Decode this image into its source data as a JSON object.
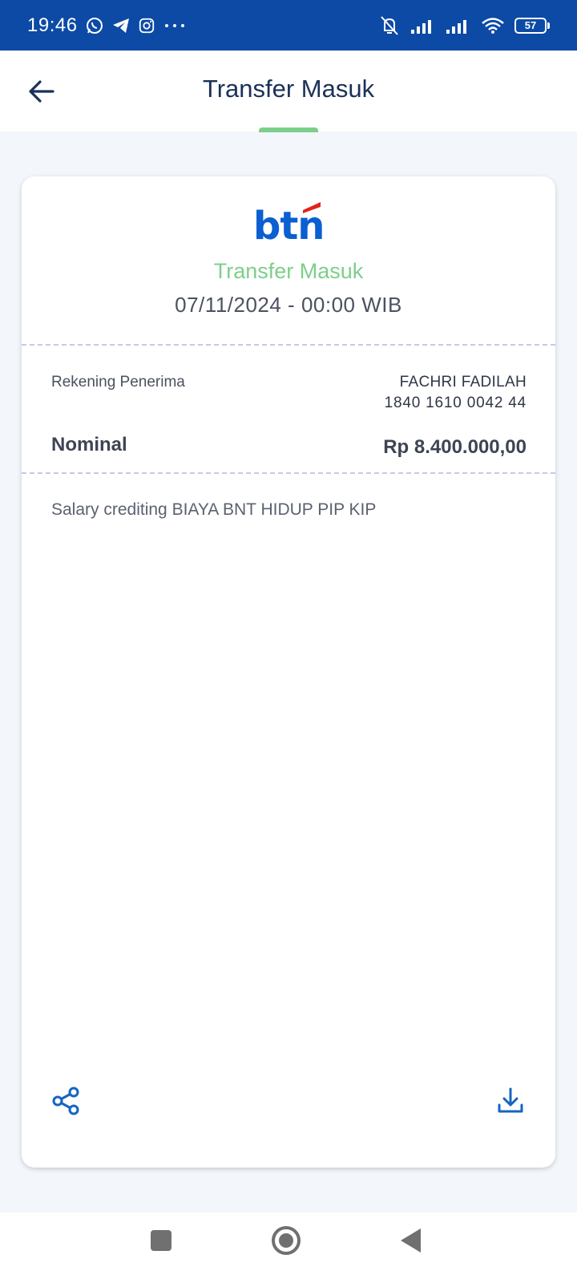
{
  "status_bar": {
    "time": "19:46",
    "battery": "57",
    "icons": [
      "whatsapp-icon",
      "telegram-icon",
      "instagram-icon",
      "more-dots-icon",
      "silent-icon",
      "signal-icon",
      "signal-icon",
      "wifi-icon",
      "battery-icon"
    ]
  },
  "header": {
    "title": "Transfer Masuk",
    "back_icon": "arrow-left-icon"
  },
  "receipt": {
    "logo_text": "btn",
    "status": "Transfer Masuk",
    "datetime": "07/11/2024 - 00:00 WIB",
    "recipient_label": "Rekening Penerima",
    "recipient_name": "FACHRI FADILAH",
    "recipient_account": "1840 1610 0042 44",
    "nominal_label": "Nominal",
    "nominal_value": "Rp 8.400.000,00",
    "description": "Salary crediting BIAYA BNT HIDUP PIP KIP",
    "share_icon": "share-icon",
    "download_icon": "download-icon"
  },
  "colors": {
    "status_bar": "#0c4aa6",
    "title": "#1b3158",
    "accent_green": "#7ccf8a",
    "brand_blue": "#0a5fd1",
    "brand_red": "#e1251b",
    "icon_blue": "#1565c0"
  }
}
